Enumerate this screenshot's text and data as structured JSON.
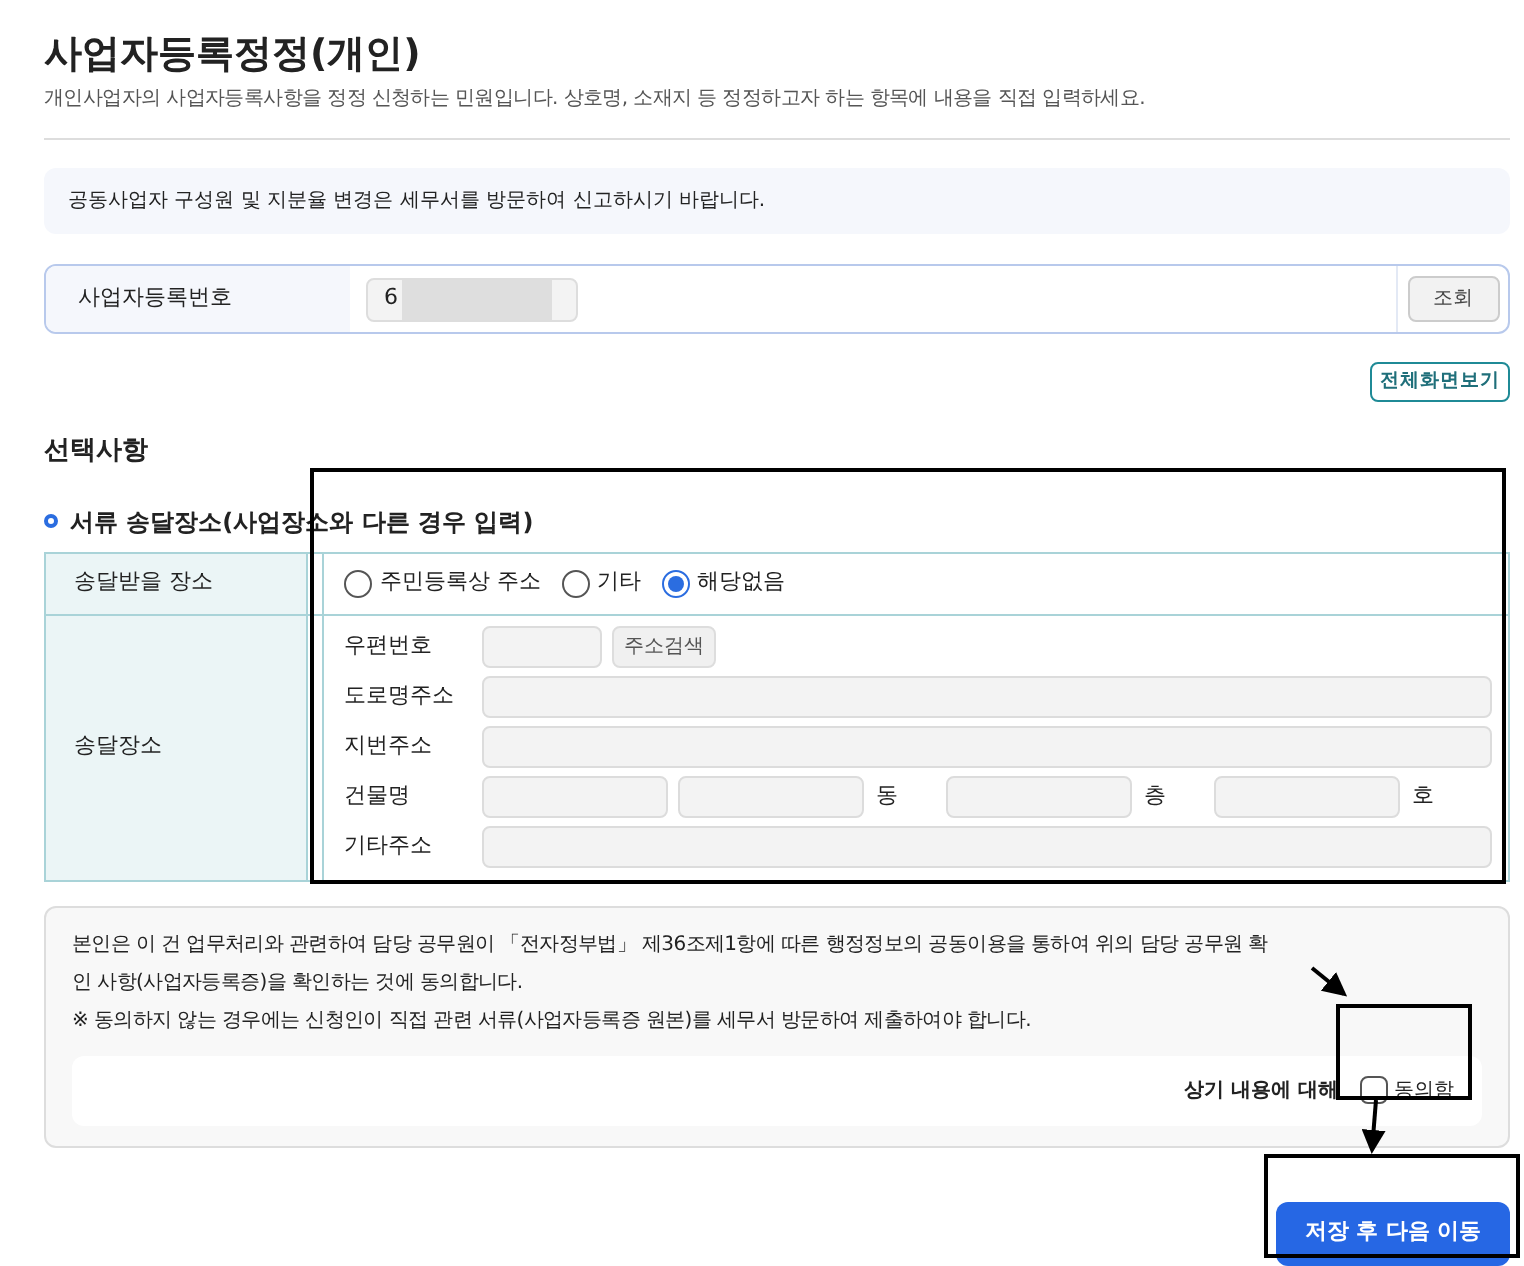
{
  "page": {
    "title": "사업자등록정정(개인)",
    "description": "개인사업자의 사업자등록사항을 정정 신청하는 민원입니다. 상호명, 소재지 등 정정하고자 하는 항목에 내용을 직접 입력하세요."
  },
  "notice": "공동사업자 구성원 및 지분율 변경은 세무서를 방문하여 신고하시기 바랍니다.",
  "registration": {
    "label": "사업자등록번호",
    "value": "6",
    "button": "조회"
  },
  "fullscreen_button": "전체화면보기",
  "section_title": "선택사항",
  "delivery": {
    "heading": "서류 송달장소(사업장소와 다른 경우 입력)",
    "place_label": "송달받을 장소",
    "options": [
      {
        "label": "주민등록상 주소",
        "selected": false
      },
      {
        "label": "기타",
        "selected": false
      },
      {
        "label": "해당없음",
        "selected": true
      }
    ],
    "address_label": "송달장소",
    "postal_label": "우편번호",
    "search_button": "주소검색",
    "road_label": "도로명주소",
    "lot_label": "지번주소",
    "building_label": "건물명",
    "dong": "동",
    "floor": "층",
    "ho": "호",
    "other_label": "기타주소"
  },
  "consent": {
    "text": "본인은 이 건 업무처리와 관련하여 담당 공무원이 「전자정부법」 제36조제1항에 따른 행정정보의 공동이용을 통하여 위의 담당 공무원 확인 사항(사업자등록증)을 확인하는 것에 동의합니다.",
    "note": "※  동의하지 않는 경우에는 신청인이 직접 관련 서류(사업자등록증 원본)를 세무서 방문하여 제출하여야 합니다.",
    "prompt": "상기 내용에 대해",
    "agree_label": "동의함",
    "checked": false
  },
  "submit_button": "저장 후 다음 이동"
}
